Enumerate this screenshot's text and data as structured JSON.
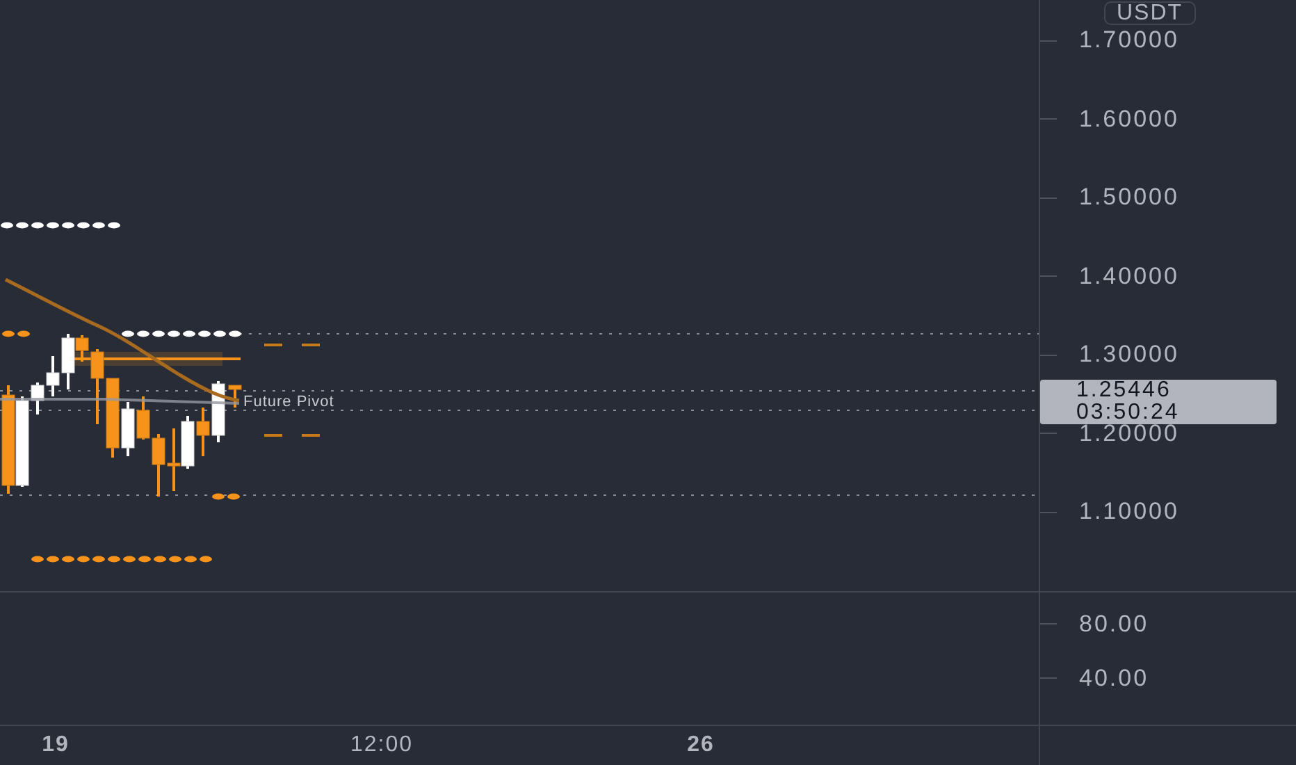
{
  "price_axis": {
    "currency": "USDT",
    "ticks": [
      "1.70000",
      "1.60000",
      "1.50000",
      "1.40000",
      "1.30000",
      "1.20000",
      "1.10000"
    ]
  },
  "last_price": {
    "price": "1.25446",
    "countdown": "03:50:24"
  },
  "chart": {
    "pivot_label": "Future Pivot"
  },
  "oscillator_axis": {
    "ticks": [
      "80.00",
      "40.00"
    ]
  },
  "time_axis": {
    "ticks": [
      {
        "label": "19",
        "kind": "day"
      },
      {
        "label": "12:00",
        "kind": "time"
      },
      {
        "label": "26",
        "kind": "day"
      }
    ]
  }
}
